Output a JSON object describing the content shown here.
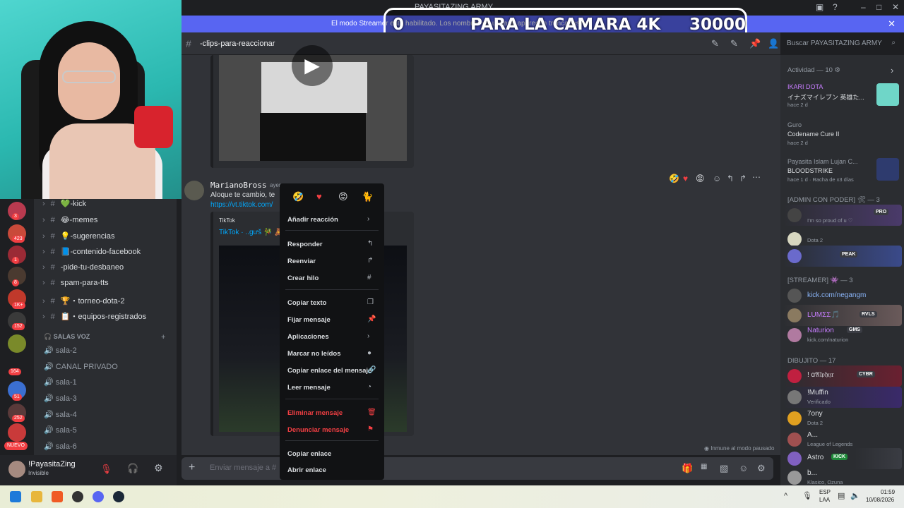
{
  "window": {
    "title": "PAYASITAZING ARMY"
  },
  "banner": {
    "message": "El modo Streamer está habilitado. Los nombres de usuario aparecen truncados.",
    "overlay_left": "0",
    "overlay_center": "PARA LA CAMARA 4K",
    "overlay_right": "30000"
  },
  "header": {
    "channel": "-clips-para-reaccionar",
    "search_placeholder": "Buscar PAYASITAZING ARMY"
  },
  "servers": {
    "badges": [
      "3",
      "423",
      "1",
      "8",
      "1K+",
      "152",
      "164",
      "51",
      "252"
    ],
    "new_label": "NUEVO"
  },
  "channels": [
    {
      "name": "💚-kick"
    },
    {
      "name": "😂-memes"
    },
    {
      "name": "💡-sugerencias"
    },
    {
      "name": "📘-contenido-facebook"
    },
    {
      "name": "-pide-tu-desbaneo"
    },
    {
      "name": "spam-para-tts"
    },
    {
      "name": "🏆・torneo-dota-2"
    },
    {
      "name": "📋・equipos-registrados"
    }
  ],
  "voice": {
    "category": "SALAS VOZ",
    "channels": [
      "sala-2",
      "CANAL PRIVADO",
      "sala-1",
      "sala-3",
      "sala-4",
      "sala-5",
      "sala-6"
    ]
  },
  "user": {
    "name": "!PayasitaZing",
    "status": "Invisible"
  },
  "message": {
    "author": "MarianoBross",
    "time": "ayer",
    "text": "Aloque te cambio, te",
    "link": "https://vt.tiktok.com/",
    "embed_provider": "TikTok",
    "embed_title": "TikTok · ..gưš 🎋 🧸"
  },
  "context_menu": {
    "add_reaction": "Añadir reacción",
    "items": [
      {
        "label": "Responder",
        "icon": "reply-icon",
        "red": false
      },
      {
        "label": "Reenviar",
        "icon": "forward-icon",
        "red": false
      },
      {
        "label": "Crear hilo",
        "icon": "thread-icon",
        "red": false
      },
      {
        "label": "Copiar texto",
        "icon": "copy-icon",
        "red": false
      },
      {
        "label": "Fijar mensaje",
        "icon": "pin-icon",
        "red": false
      },
      {
        "label": "Aplicaciones",
        "icon": "chevron-right-icon",
        "red": false
      },
      {
        "label": "Marcar no leídos",
        "icon": "unread-icon",
        "red": false
      },
      {
        "label": "Copiar enlace del mensaje",
        "icon": "link-icon",
        "red": false
      },
      {
        "label": "Leer mensaje",
        "icon": "speak-icon",
        "red": false
      },
      {
        "label": "Eliminar mensaje",
        "icon": "trash-icon",
        "red": true
      },
      {
        "label": "Denunciar mensaje",
        "icon": "flag-icon",
        "red": true
      },
      {
        "label": "Copiar enlace",
        "icon": "",
        "red": false
      },
      {
        "label": "Abrir enlace",
        "icon": "",
        "red": false
      }
    ]
  },
  "composer": {
    "placeholder": "Enviar mensaje a #"
  },
  "chat_footer": {
    "paused": "Inmune al modo pausado"
  },
  "members": {
    "activity": "Actividad — 10",
    "act1_name": "IKARI DOTA",
    "act1_game": "イナズマイレブン 英雄た...",
    "act1_time": "hace 2 d",
    "act2_name": "Guro",
    "act2_game": "Codename Cure II",
    "act2_time": "hace 2 d",
    "act3_name": "Payasita Islam Lujan C...",
    "act3_game": "BLOODSTRIKE",
    "act3_time": "hace 1 d · Racha de x3 días",
    "admin_header": "[ADMIN CON PODER] 🛠 — 3",
    "admin1_sub": "I'm so proud of u ♡",
    "admin1_tag": "PRO",
    "admin2_sub": "Dota 2",
    "admin3_tag": "PEAK",
    "streamer_header": "[STREAMER] 👾 — 3",
    "str1": "kick.com/negangm",
    "str2": "LUMΣΣ🎵",
    "str2_tag": "RVLS",
    "str3": "Naturion",
    "str3_tag": "GMS",
    "str3_sub": "kick.com/naturion",
    "dib_header": "DIBUJITO — 17",
    "dib1": "! ɑ𝔄𝔩𝔭𝔥𝔶𝔯",
    "dib1_tag": "CYBR",
    "dib2": "!Muffin",
    "dib2_sub": "Verificado",
    "dib3": "7ony",
    "dib3_sub": "Dota 2",
    "dib4": "A...",
    "dib4_sub": "League of Legends",
    "dib5": "Astro",
    "dib5_tag": "KICK",
    "dib6": "b...",
    "dib6_sub": "Klasico, Ozuna"
  },
  "taskbar": {
    "lang": "ESP",
    "region": "LAA",
    "time": "01:59",
    "date": "10/08/2026"
  }
}
